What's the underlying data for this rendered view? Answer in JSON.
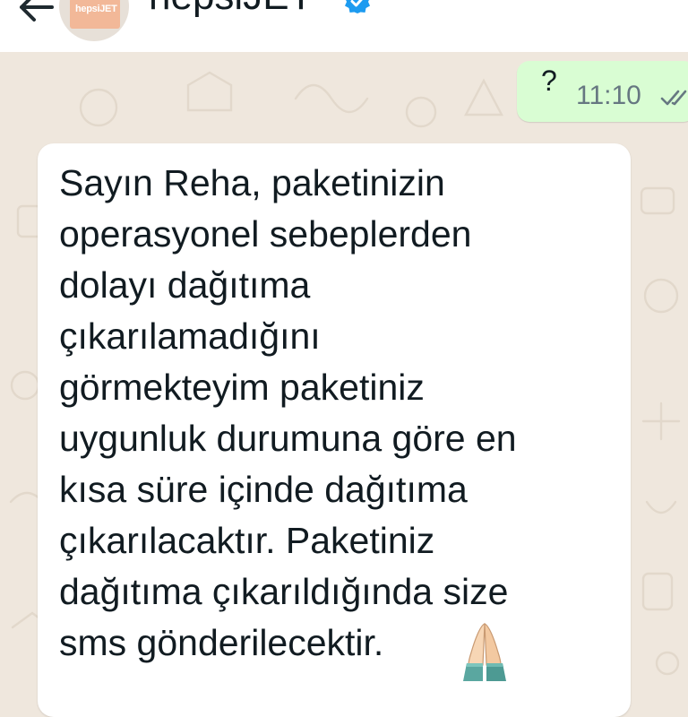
{
  "header": {
    "contact_name": "hepsiJET",
    "avatar_logo_text": "hepsiJET",
    "icons": {
      "back": "arrow-left-icon",
      "verified": "verified-badge-icon"
    }
  },
  "messages": [
    {
      "direction": "outgoing",
      "text": "?",
      "time": "11:10",
      "status": "read",
      "status_icon": "double-check-icon"
    },
    {
      "direction": "incoming",
      "lines": [
        "Sayın Reha, paketinizin",
        "operasyonel sebeplerden",
        "dolayı dağıtıma",
        "çıkarılamadığını",
        "görmekteyim paketiniz",
        "uygunluk durumuna göre en",
        "kısa süre içinde dağıtıma",
        "çıkarılacaktır. Paketiniz",
        "dağıtıma çıkarıldığında size",
        "sms gönderilecektir."
      ],
      "emoji_icon": "folded-hands-icon"
    }
  ],
  "colors": {
    "header_bg": "#ffffff",
    "chat_bg": "#efe7dd",
    "outgoing_bubble": "#d9fdd3",
    "incoming_bubble": "#ffffff",
    "verified_blue": "#1d9bf0",
    "meta_text": "#667781"
  }
}
